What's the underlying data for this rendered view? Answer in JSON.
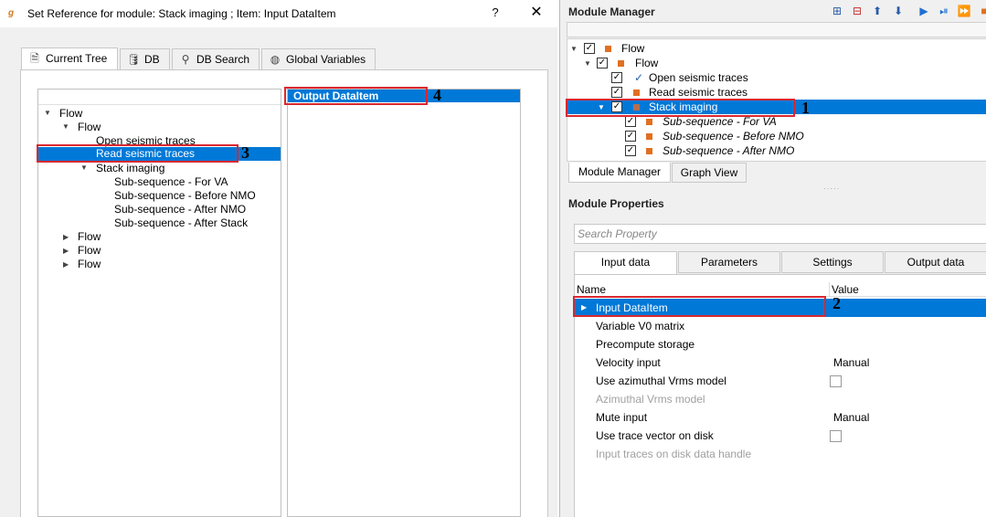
{
  "dialog": {
    "title": "Set Reference for module: Stack imaging ; Item: Input DataItem",
    "help": "?",
    "close": "✕",
    "tabs": [
      {
        "label": "Current Tree",
        "icon": "tree-icon"
      },
      {
        "label": "DB",
        "icon": "database-icon"
      },
      {
        "label": "DB Search",
        "icon": "search-icon"
      },
      {
        "label": "Global Variables",
        "icon": "globe-icon"
      }
    ],
    "tree": {
      "root": "Flow",
      "flow": "Flow",
      "open": "Open seismic traces",
      "read": "Read seismic traces",
      "stack": "Stack imaging",
      "sub1": "Sub-sequence - For VA",
      "sub2": "Sub-sequence - Before NMO",
      "sub3": "Sub-sequence - After NMO",
      "sub4": "Sub-sequence - After Stack",
      "flow2": "Flow",
      "flow3": "Flow",
      "flow4": "Flow"
    },
    "output_item": "Output DataItem"
  },
  "module_manager": {
    "title": "Module Manager",
    "tree": {
      "flow_root": "Flow",
      "flow": "Flow",
      "open": "Open seismic traces",
      "read": "Read seismic traces",
      "stack": "Stack imaging",
      "sub1": "Sub-sequence - For VA",
      "sub2": "Sub-sequence - Before NMO",
      "sub3": "Sub-sequence - After NMO"
    },
    "bottom_tabs": [
      "Module Manager",
      "Graph View"
    ]
  },
  "module_properties": {
    "title": "Module Properties",
    "search_placeholder": "Search Property",
    "tabs": [
      "Input data",
      "Parameters",
      "Settings",
      "Output data"
    ],
    "col_name": "Name",
    "col_value": "Value",
    "rows": [
      {
        "name": "Input DataItem",
        "value": ""
      },
      {
        "name": "Variable V0 matrix",
        "value": ""
      },
      {
        "name": "Precompute storage",
        "value": ""
      },
      {
        "name": "Velocity input",
        "value": "Manual"
      },
      {
        "name": "Use azimuthal Vrms model",
        "value": ""
      },
      {
        "name": "Azimuthal Vrms model",
        "value": ""
      },
      {
        "name": "Mute input",
        "value": "Manual"
      },
      {
        "name": "Use trace vector on disk",
        "value": ""
      },
      {
        "name": "Input traces on disk data handle",
        "value": ""
      }
    ]
  },
  "annotations": [
    "1",
    "2",
    "3",
    "4"
  ],
  "colors": {
    "selection": "#0078d7",
    "highlight": "#d9282f",
    "module_square": "#e07020"
  }
}
